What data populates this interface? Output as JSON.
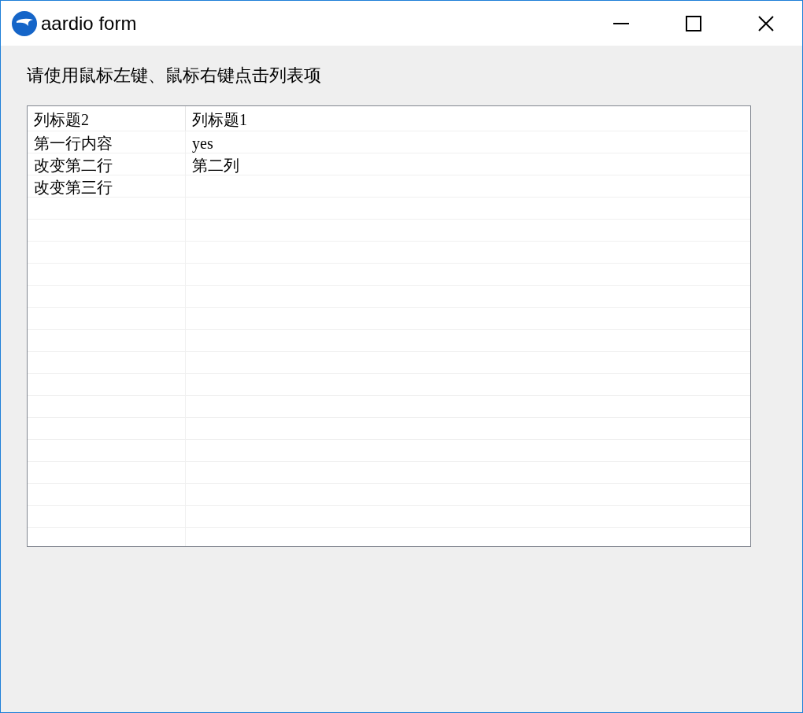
{
  "window": {
    "title": "aardio form"
  },
  "instruction": "请使用鼠标左键、鼠标右键点击列表项",
  "table": {
    "columns": [
      "列标题2",
      "列标题1"
    ],
    "rows": [
      [
        "第一行内容",
        "yes"
      ],
      [
        "改变第二行",
        "第二列"
      ],
      [
        "改变第三行"
      ]
    ]
  }
}
